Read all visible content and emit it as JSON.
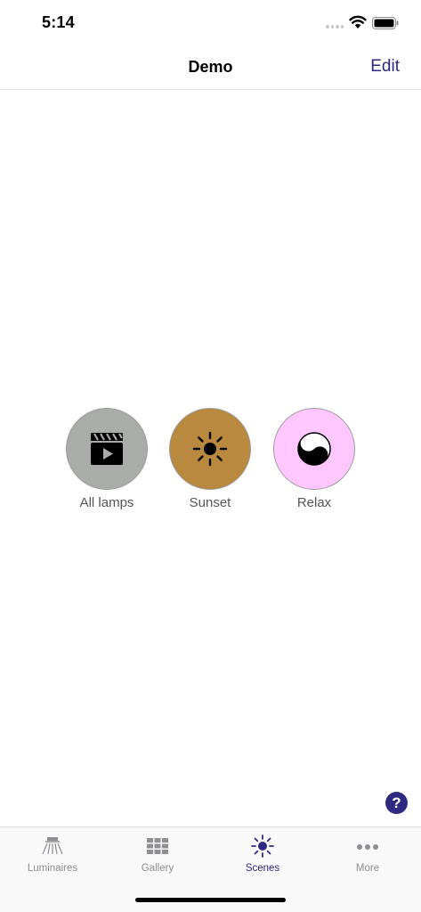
{
  "status_bar": {
    "time": "5:14"
  },
  "nav": {
    "title": "Demo",
    "edit_label": "Edit"
  },
  "scenes": [
    {
      "label": "All lamps",
      "color": "#a9aca9",
      "icon": "clapperboard-icon"
    },
    {
      "label": "Sunset",
      "color": "#b8893e",
      "icon": "sun-icon"
    },
    {
      "label": "Relax",
      "color": "#ffc7ff",
      "icon": "yin-yang-icon"
    }
  ],
  "help": {
    "label": "?"
  },
  "tab_bar": {
    "active_color": "#2f2a7f",
    "tabs": [
      {
        "label": "Luminaires",
        "icon": "luminaire-icon",
        "active": false
      },
      {
        "label": "Gallery",
        "icon": "grid-icon",
        "active": false
      },
      {
        "label": "Scenes",
        "icon": "sun-icon",
        "active": true
      },
      {
        "label": "More",
        "icon": "more-dots-icon",
        "active": false
      }
    ]
  }
}
